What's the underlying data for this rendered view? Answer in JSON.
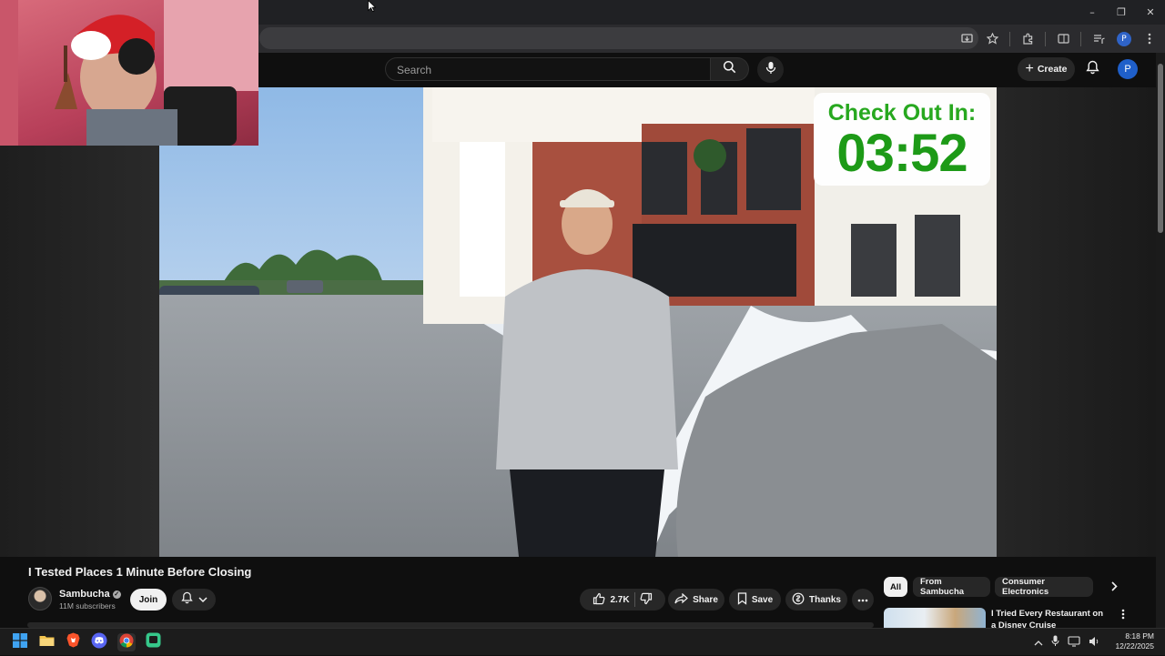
{
  "browser": {
    "window_controls": {
      "minimize": "–",
      "restore": "❐",
      "close": "✕"
    },
    "profile_initial": "P"
  },
  "header": {
    "search_placeholder": "Search",
    "create_label": "Create",
    "avatar_initial": "P"
  },
  "overlay": {
    "countdown_label": "Check Out In:",
    "countdown_time": "03:52"
  },
  "video": {
    "title": "I Tested Places 1 Minute Before Closing",
    "channel_name": "Sambucha",
    "subscribers": "11M subscribers",
    "join_label": "Join",
    "like_count": "2.7K",
    "share_label": "Share",
    "save_label": "Save",
    "thanks_label": "Thanks"
  },
  "chips": [
    "All",
    "From Sambucha",
    "Consumer Electronics"
  ],
  "recommendation": {
    "title": "I Tried Every Restaurant on a Disney Cruise"
  },
  "taskbar": {
    "time": "8:18 PM",
    "date": "12/22/2025"
  },
  "colors": {
    "background": "#0f0f0f",
    "countdown_green": "#1d9a17",
    "profile_blue": "#1f5fc9"
  }
}
